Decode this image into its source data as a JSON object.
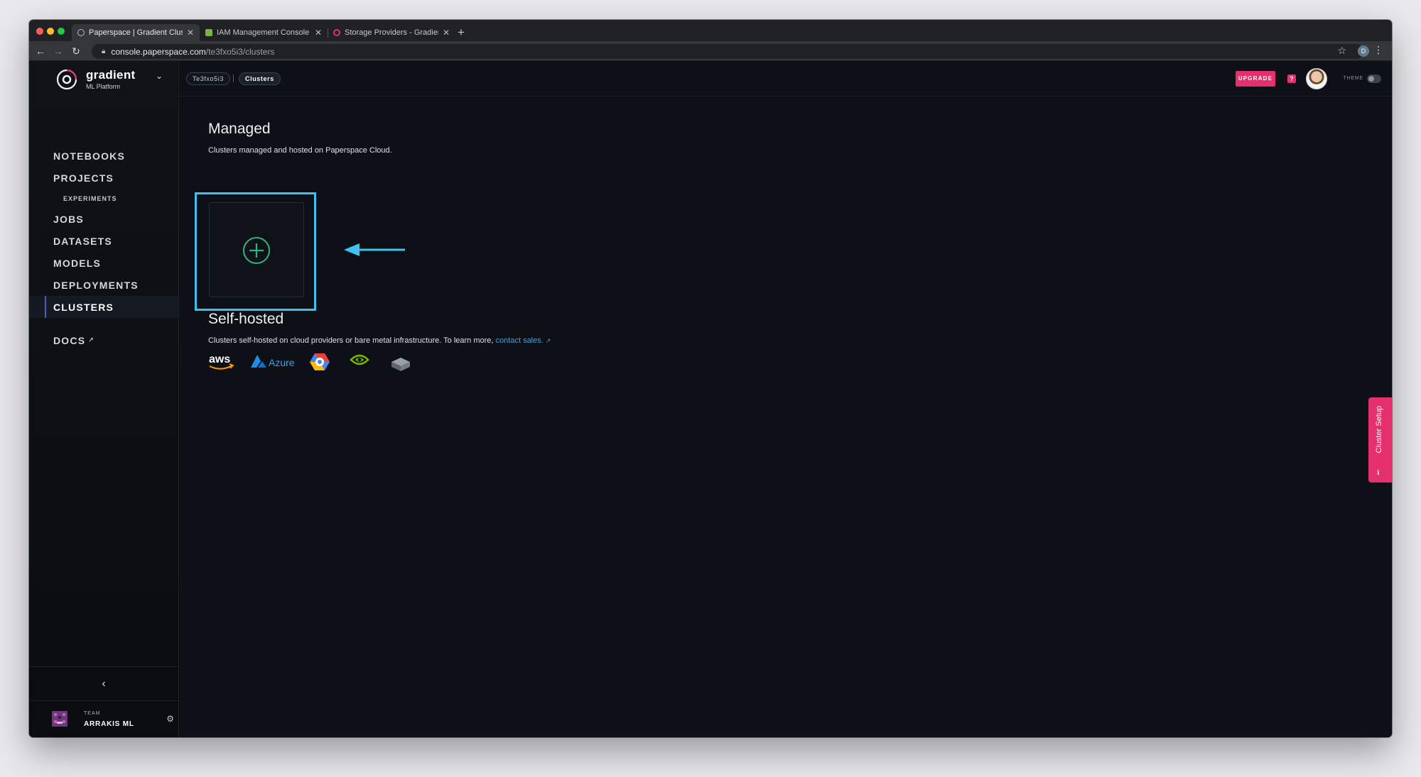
{
  "browser": {
    "tabs": [
      {
        "label": "Paperspace | Gradient Clusters",
        "active": true
      },
      {
        "label": "IAM Management Console",
        "active": false
      },
      {
        "label": "Storage Providers - Gradient D",
        "active": false
      }
    ],
    "url": {
      "domain": "console.paperspace.com",
      "path": "/te3fxo5i3/clusters"
    },
    "profile_initial": "D"
  },
  "brand": {
    "name": "gradient",
    "subtitle": "ML Platform"
  },
  "sidebar": {
    "items": [
      {
        "label": "NOTEBOOKS"
      },
      {
        "label": "PROJECTS"
      },
      {
        "label": "EXPERIMENTS"
      },
      {
        "label": "JOBS"
      },
      {
        "label": "DATASETS"
      },
      {
        "label": "MODELS"
      },
      {
        "label": "DEPLOYMENTS"
      },
      {
        "label": "CLUSTERS"
      },
      {
        "label": "DOCS"
      }
    ],
    "team_label": "TEAM",
    "team_name": "ARRAKIS ML"
  },
  "header": {
    "team_id": "Te3fxo5i3",
    "page": "Clusters",
    "upgrade_label": "UPGRADE",
    "help_label": "?",
    "theme_label": "THEME"
  },
  "managed": {
    "title": "Managed",
    "description": "Clusters managed and hosted on Paperspace Cloud."
  },
  "self_hosted": {
    "title": "Self-hosted",
    "description": "Clusters self-hosted on cloud providers or bare metal infrastructure. To learn more,",
    "link_text": "contact sales.",
    "providers": [
      "aws",
      "Azure",
      "gcp",
      "nvidia",
      "bare-metal"
    ]
  },
  "side_tab": {
    "label": "Cluster Setup"
  },
  "colors": {
    "accent_pink": "#e5306e",
    "highlight_blue": "#3fc2ef",
    "plus_green": "#2fb57a",
    "background": "#0d1016"
  }
}
